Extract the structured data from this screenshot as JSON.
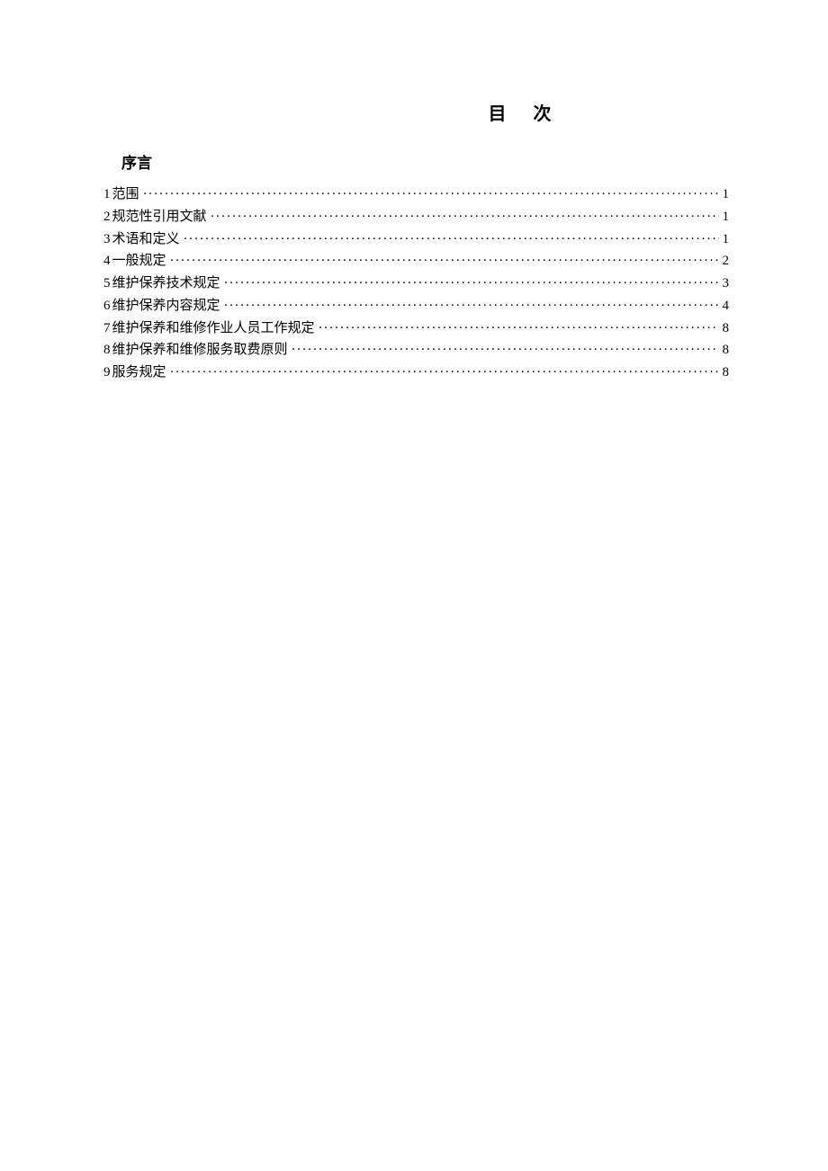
{
  "title": "目次",
  "preface": "序言",
  "toc": [
    {
      "num": "1",
      "label": "范围",
      "page": "1"
    },
    {
      "num": "2",
      "label": "规范性引用文献",
      "page": "1"
    },
    {
      "num": "3",
      "label": "术语和定义",
      "page": "1"
    },
    {
      "num": "4",
      "label": "一般规定",
      "page": "2"
    },
    {
      "num": "5",
      "label": "维护保养技术规定",
      "page": "3"
    },
    {
      "num": "6",
      "label": "维护保养内容规定",
      "page": "4"
    },
    {
      "num": "7",
      "label": "维护保养和维修作业人员工作规定",
      "page": "8"
    },
    {
      "num": "8",
      "label": "维护保养和维修服务取费原则",
      "page": "8"
    },
    {
      "num": "9",
      "label": "服务规定",
      "page": "8"
    }
  ]
}
